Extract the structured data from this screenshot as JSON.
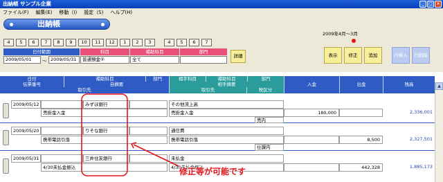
{
  "window": {
    "title": "出納帳 サンプル企業"
  },
  "menu": [
    "ファイル(F)",
    "編集(E)",
    "移動（I)",
    "設定（S)",
    "ヘルプ(H)"
  ],
  "header": {
    "title": "出納帳",
    "period": "2009年4月～3月",
    "months": [
      "4",
      "5",
      "6",
      "7",
      "8",
      "9",
      "10",
      "11",
      "12",
      "1",
      "2",
      "3",
      "4",
      "5",
      "6",
      "7"
    ],
    "filter_labels": {
      "date_range": "日付範囲",
      "account": "科目",
      "sub_account": "補助科目",
      "department": "部門"
    },
    "filter_values": {
      "date_from": "2009/05/01",
      "tilde": "～",
      "date_to": "2009/05/31",
      "account": "普通預金②",
      "sub_account": "全て",
      "department": ""
    },
    "detail_button": "詳細",
    "actions": {
      "display": "表示",
      "edit": "修正",
      "add": "追加",
      "row_insert": "行挿入",
      "row_delete": "行削除"
    }
  },
  "grid": {
    "headers": {
      "date": "日付",
      "voucher_no": "伝票番号",
      "sub_account": "補助科目",
      "department": "部門",
      "summary": "自摘要",
      "client": "取引先",
      "other_account": "相手科目",
      "other_sub_account": "補助科目",
      "other_department": "部門",
      "other_summary": "相手摘要",
      "other_client": "取引先",
      "tax_class": "税区分",
      "deposit": "入金",
      "withdrawal": "出金",
      "balance": "残高"
    },
    "rows": [
      {
        "date": "2009/05/12",
        "sub_account": "みずほ銀行",
        "summary": "売掛金入金",
        "other_account": "その他流上高",
        "other_summary": "売掛金入金",
        "tax_class": "売内",
        "deposit": "180,000",
        "withdrawal": "",
        "balance": "2,336,001"
      },
      {
        "date": "2009/05/20",
        "sub_account": "りそな銀行",
        "summary": "携帯電話引落",
        "other_account": "通信費",
        "other_summary": "携帯電話引落",
        "tax_class": "仕課内",
        "deposit": "",
        "withdrawal": "8,500",
        "balance": "2,327,501"
      },
      {
        "date": "2009/05/31",
        "sub_account": "三井住友銀行",
        "summary": "4/30未払金振込",
        "other_account": "未払金",
        "other_summary": "4/30未払金振込",
        "tax_class": "",
        "deposit": "",
        "withdrawal": "442,328",
        "balance": "1,885,173"
      }
    ]
  },
  "annotation": "修正等が可能です",
  "colors": {
    "header_blue": "#2f5cc4",
    "header_teal": "#2a9c9c",
    "annotation_red": "#e3141b",
    "button_yellow": "#f7ef9a"
  }
}
